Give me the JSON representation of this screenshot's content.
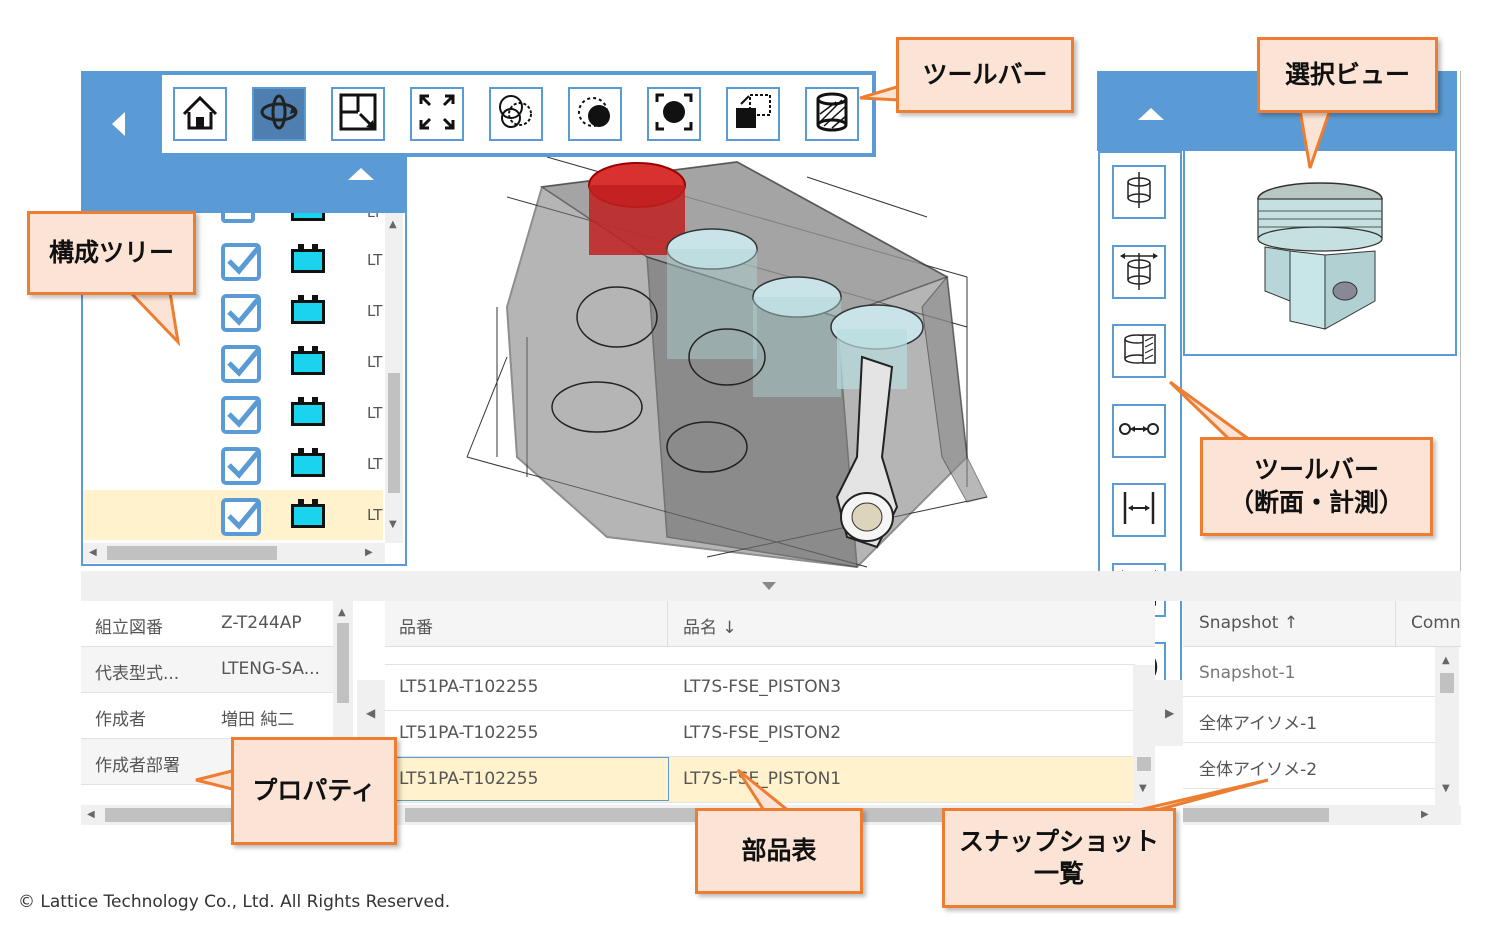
{
  "toolbar": {
    "buttons": [
      {
        "icon": "home-icon",
        "active": false
      },
      {
        "icon": "rotate-icon",
        "active": true
      },
      {
        "icon": "zoom-window-icon",
        "active": false
      },
      {
        "icon": "fit-all-icon",
        "active": false
      },
      {
        "icon": "transparency-icon",
        "active": false
      },
      {
        "icon": "select-dashed-icon",
        "active": false
      },
      {
        "icon": "fit-selected-icon",
        "active": false
      },
      {
        "icon": "move-icon",
        "active": false
      },
      {
        "icon": "section-cylinder-icon",
        "active": false
      }
    ]
  },
  "measure_toolbar": {
    "buttons": [
      {
        "icon": "section-plane-icon"
      },
      {
        "icon": "section-plane-resize-icon"
      },
      {
        "icon": "section-box-icon"
      },
      {
        "icon": "point-distance-icon"
      },
      {
        "icon": "edge-distance-icon"
      },
      {
        "icon": "face-distance-icon"
      },
      {
        "icon": "diameter-icon"
      }
    ]
  },
  "tree": {
    "rows": [
      {
        "label": "LT",
        "checked": true,
        "selected": false
      },
      {
        "label": "LT",
        "checked": true,
        "selected": false
      },
      {
        "label": "LT",
        "checked": true,
        "selected": false
      },
      {
        "label": "LT",
        "checked": true,
        "selected": false
      },
      {
        "label": "LT",
        "checked": true,
        "selected": false
      },
      {
        "label": "LT",
        "checked": true,
        "selected": true
      }
    ],
    "partial_label": "LT"
  },
  "properties": {
    "rows": [
      {
        "key": "組立図番",
        "value": "Z-T244AP"
      },
      {
        "key": "代表型式...",
        "value": "LTENG-SA..."
      },
      {
        "key": "作成者",
        "value": "増田 純二"
      },
      {
        "key": "作成者部署",
        "value": ""
      }
    ]
  },
  "bom": {
    "headers": [
      "品番",
      "品名 ↓"
    ],
    "rows": [
      {
        "part_no": "LT51PA-T102255",
        "name": "LT7S-FSE_PISTON3",
        "selected": false
      },
      {
        "part_no": "LT51PA-T102255",
        "name": "LT7S-FSE_PISTON2",
        "selected": false
      },
      {
        "part_no": "LT51PA-T102255",
        "name": "LT7S-FSE_PISTON1",
        "selected": true
      }
    ]
  },
  "snapshots": {
    "headers": [
      "Snapshot ↑",
      "Comn"
    ],
    "rows": [
      "Snapshot-1",
      "全体アイソメ-1",
      "全体アイソメ-2"
    ]
  },
  "callouts": {
    "toolbar": "ツールバー",
    "selection_view": "選択ビュー",
    "tree": "構成ツリー",
    "measure_toolbar_line1": "ツールバー",
    "measure_toolbar_line2": "（断面・計測）",
    "properties": "プロパティ",
    "bom": "部品表",
    "snapshot_line1": "スナップショット",
    "snapshot_line2": "一覧"
  },
  "copyright": "© Lattice Technology Co., Ltd. All Rights Reserved.",
  "colors": {
    "accent": "#5b9bd5",
    "callout_fill": "#fbe4d5",
    "callout_border": "#ed7d31",
    "selected_row": "#fff2cc"
  }
}
